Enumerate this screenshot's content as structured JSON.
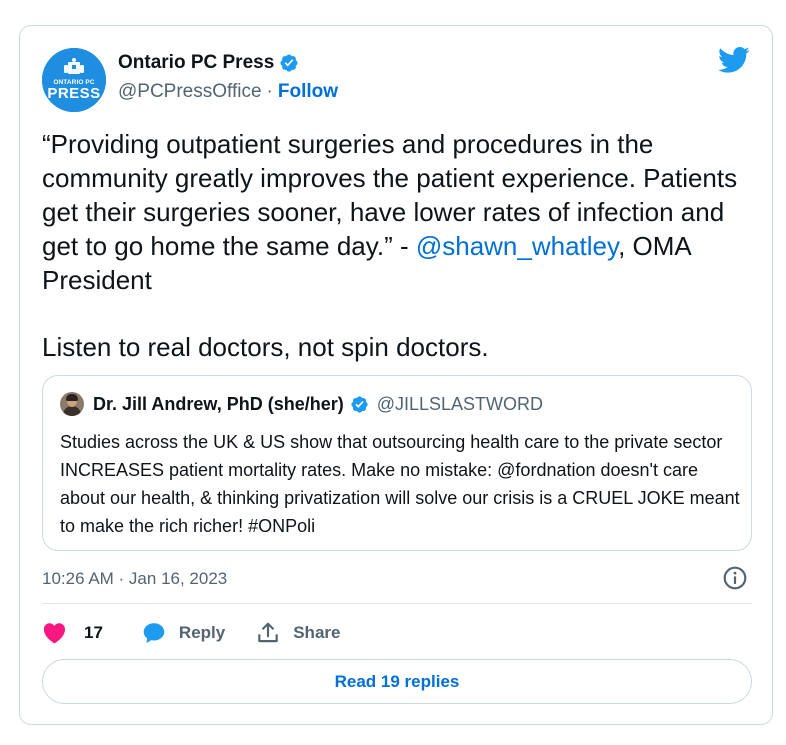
{
  "author": {
    "display_name": "Ontario PC Press",
    "handle": "@PCPressOffice",
    "separator": "·",
    "follow_label": "Follow",
    "avatar_text_top": "ONTARIO PC",
    "avatar_text_bottom": "PRESS",
    "verified_icon": "verified-badge-icon"
  },
  "tweet": {
    "quote_text": "“Providing outpatient surgeries and procedures in the community greatly improves the patient experience. Patients get their surgeries sooner, have lower rates of infection and get to go home the same day.” -",
    "mention": "@shawn_whatley",
    "mention_suffix": ", OMA President",
    "second_paragraph": "Listen to real doctors, not spin doctors."
  },
  "quoted_tweet": {
    "display_name": "Dr. Jill Andrew, PhD (she/her)",
    "handle": "@JILLSLASTWORD",
    "text": "Studies across the UK & US show that outsourcing health care to the private sector INCREASES patient mortality rates. Make no mistake: @fordnation doesn't care about our health, & thinking privatization will solve our crisis is a CRUEL JOKE meant to make the rich richer! #ONPoli"
  },
  "meta": {
    "timestamp": "10:26 AM · Jan 16, 2023"
  },
  "actions": {
    "like_count": "17",
    "reply_label": "Reply",
    "share_label": "Share",
    "read_replies_label": "Read 19 replies"
  },
  "colors": {
    "accent": "#1d9bf0",
    "link": "#006fd6",
    "like": "#f91880",
    "secondary_text": "#536471",
    "border": "#cfd9de"
  }
}
